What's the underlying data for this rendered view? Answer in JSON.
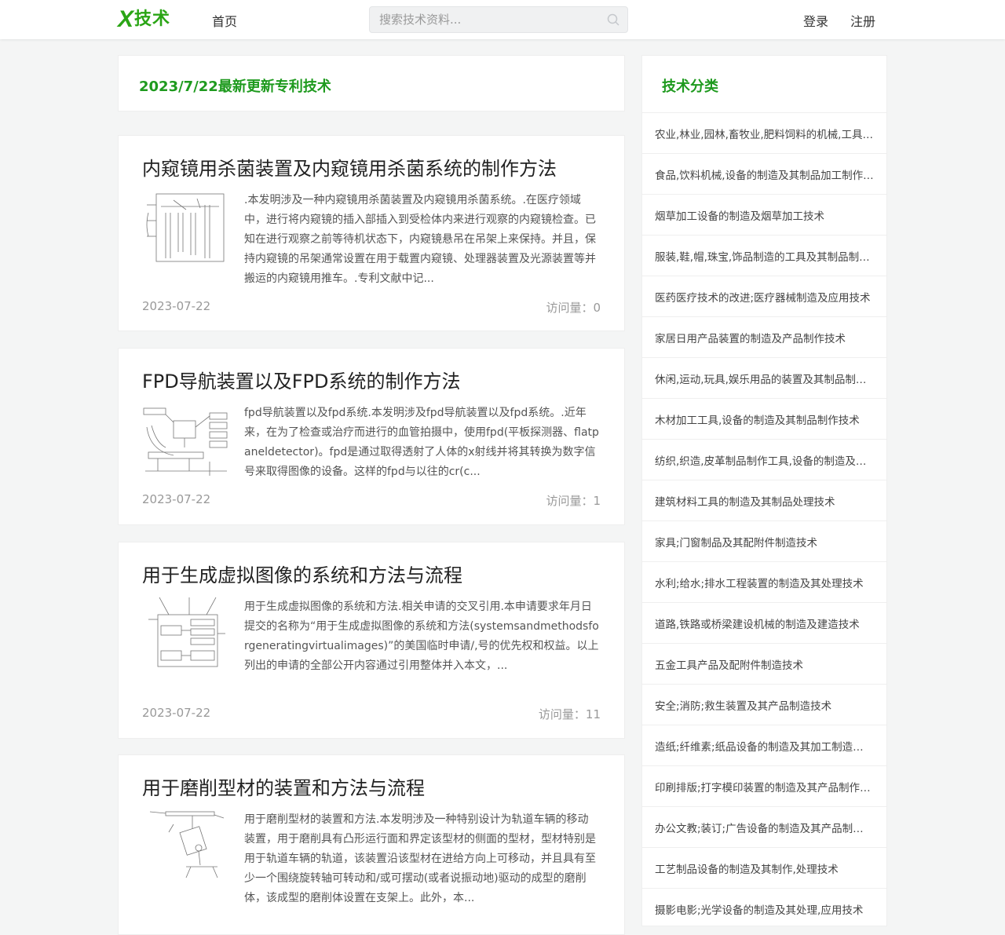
{
  "header": {
    "logo_mark": "X",
    "logo_text": "技术",
    "nav_home": "首页",
    "search_placeholder": "搜索技术资料...",
    "login": "登录",
    "register": "注册"
  },
  "main": {
    "date_title": "2023/7/22最新更新专利技术",
    "articles": [
      {
        "title": "内窥镜用杀菌装置及内窥镜用杀菌系统的制作方法",
        "description": ".本发明涉及一种内窥镜用杀菌装置及内窥镜用杀菌系统。.在医疗领域中，进行将内窥镜的插入部插入到受检体内来进行观察的内窥镜检查。已知在进行观察之前等待机状态下，内窥镜悬吊在吊架上来保持。并且，保持内窥镜的吊架通常设置在用于载置内窥镜、处理器装置及光源装置等并搬运的内窥镜用推车。.专利文献中记...",
        "date": "2023-07-22",
        "views": "访问量：0"
      },
      {
        "title": "FPD导航装置以及FPD系统的制作方法",
        "description": "fpd导航装置以及fpd系统.本发明涉及fpd导航装置以及fpd系统。.近年来，在为了检查或治疗而进行的血管拍摄中，使用fpd(平板探测器、flatpaneldetector)。fpd是通过取得透射了人体的x射线并将其转换为数字信号来取得图像的设备。这样的fpd与以往的cr(c...",
        "date": "2023-07-22",
        "views": "访问量：1"
      },
      {
        "title": "用于生成虚拟图像的系统和方法与流程",
        "description": "用于生成虚拟图像的系统和方法.相关申请的交叉引用.本申请要求年月日提交的名称为“用于生成虚拟图像的系统和方法(systemsandmethodsforgeneratingvirtualimages)”的美国临时申请/,号的优先权和权益。以上列出的申请的全部公开内容通过引用整体并入本文，...",
        "date": "2023-07-22",
        "views": "访问量：11"
      },
      {
        "title": "用于磨削型材的装置和方法与流程",
        "description": "用于磨削型材的装置和方法.本发明涉及一种特别设计为轨道车辆的移动装置，用于磨削具有凸形运行面和界定该型材的侧面的型材，型材特别是用于轨道车辆的轨道，该装置沿该型材在进给方向上可移动，并且具有至少一个围绕旋转轴可转动和/或可摆动(或者说振动地)驱动的成型的磨削体，该成型的磨削体设置在支架上。此外，本...",
        "date": "",
        "views": ""
      }
    ]
  },
  "sidebar": {
    "title": "技术分类",
    "items": [
      "农业,林业,园林,畜牧业,肥料饲料的机械,工具制造及其应用技术",
      "食品,饮料机械,设备的制造及其制品加工制作,储存技术",
      "烟草加工设备的制造及烟草加工技术",
      "服装,鞋,帽,珠宝,饰品制造的工具及其制品制作技术",
      "医药医疗技术的改进;医疗器械制造及应用技术",
      "家居日用产品装置的制造及产品制作技术",
      "休闲,运动,玩具,娱乐用品的装置及其制品制作技术",
      "木材加工工具,设备的制造及其制品制作技术",
      "纺织,织造,皮革制品制作工具,设备的制造及其制品制作技术",
      "建筑材料工具的制造及其制品处理技术",
      "家具;门窗制品及其配附件制造技术",
      "水利;给水;排水工程装置的制造及其处理技术",
      "道路,铁路或桥梁建设机械的制造及建造技术",
      "五金工具产品及配附件制造技术",
      "安全;消防;救生装置及其产品制造技术",
      "造纸;纤维素;纸品设备的制造及其加工制造技术",
      "印刷排版;打字模印装置的制造及其产品制作技术",
      "办公文教;装订;广告设备的制造及其产品制作技术",
      "工艺制品设备的制造及其制作,处理技术",
      "摄影电影;光学设备的制造及其处理,应用技术"
    ]
  },
  "colors": {
    "brand_green": "#2aa515",
    "title_green": "#1e9a1e"
  }
}
